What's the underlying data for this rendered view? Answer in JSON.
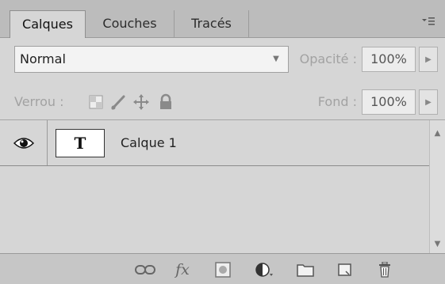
{
  "tabs": [
    {
      "label": "Calques",
      "active": true
    },
    {
      "label": "Couches",
      "active": false
    },
    {
      "label": "Tracés",
      "active": false
    }
  ],
  "tab_menu_icon": "panel-menu-icon",
  "options": {
    "blend_mode": "Normal",
    "opacity_label": "Opacité :",
    "opacity_value": "100%",
    "lock_label": "Verrou :",
    "fill_label": "Fond :",
    "fill_value": "100%"
  },
  "lock_icons": [
    "lock-transparent-pixels-icon",
    "lock-image-pixels-icon",
    "lock-position-icon",
    "lock-all-icon"
  ],
  "layers": [
    {
      "name": "Calque 1",
      "thumbnail": "T",
      "visible": true
    }
  ],
  "bottom_icons": [
    "link-layers-icon",
    "fx-icon",
    "add-mask-icon",
    "adjustment-layer-icon",
    "new-group-icon",
    "new-layer-icon",
    "delete-layer-icon"
  ],
  "fx_label": "fx",
  "colors": {
    "panel_bg": "#d6d6d6",
    "tabbar_bg": "#bcbcbc",
    "bottombar_bg": "#c6c6c6"
  }
}
